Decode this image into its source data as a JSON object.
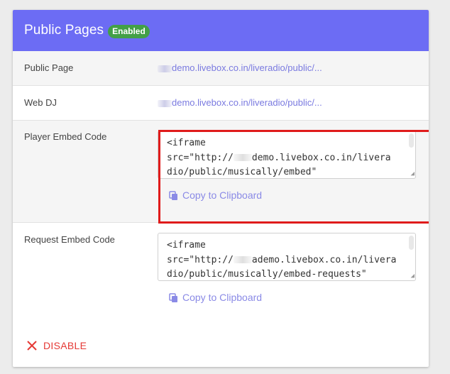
{
  "header": {
    "title": "Public Pages",
    "status_badge": "Enabled"
  },
  "rows": {
    "public_page": {
      "label": "Public Page",
      "link": "demo.livebox.co.in/liveradio/public/..."
    },
    "web_dj": {
      "label": "Web DJ",
      "link": "demo.livebox.co.in/liveradio/public/..."
    },
    "player_embed": {
      "label": "Player Embed Code",
      "code_line1": "<iframe",
      "code_line2_prefix": "src=\"http://",
      "code_line2_suffix": "demo.livebox.co.in/livera",
      "code_line3": "dio/public/musically/embed\"",
      "copy_label": "Copy to Clipboard"
    },
    "request_embed": {
      "label": "Request Embed Code",
      "code_line1": "<iframe",
      "code_line2_prefix": "src=\"http://",
      "code_line2_suffix": "ademo.livebox.co.in/livera",
      "code_line3": "dio/public/musically/embed-requests\"",
      "copy_label": "Copy to Clipboard"
    }
  },
  "footer": {
    "disable_label": "DISABLE"
  },
  "colors": {
    "header_bg": "#6c6cf4",
    "badge_bg": "#43a047",
    "link": "#7a7ae0",
    "highlight_border": "#e01b1b",
    "disable": "#e53935"
  },
  "icons": {
    "copy": "copy-icon",
    "disable": "close-icon"
  }
}
